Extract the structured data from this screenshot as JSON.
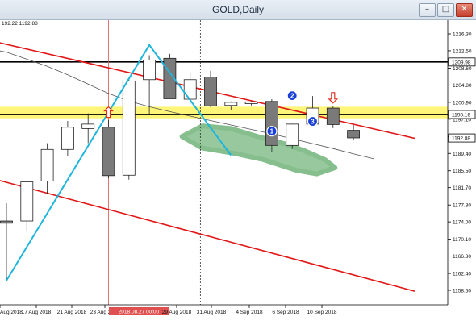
{
  "window": {
    "title": "GOLD,Daily",
    "minimize_icon": "minimize-icon",
    "maximize_icon": "maximize-icon",
    "close_icon": "close-icon"
  },
  "ohlc_readout": "192.22 1192.88",
  "chart_data": {
    "type": "candlestick",
    "price_axis_ticks": [
      "1216.30",
      "1212.50",
      "1208.60",
      "1204.80",
      "1200.90",
      "1197.10",
      "1193.20",
      "1189.40",
      "1185.50",
      "1181.70",
      "1177.80",
      "1174.00",
      "1170.10",
      "1166.30",
      "1162.40",
      "1158.60"
    ],
    "price_labels": [
      {
        "value": "1209.98",
        "bg": "#ffffff",
        "fg": "#000000"
      },
      {
        "value": "1198.16",
        "bg": "#ffffff",
        "fg": "#000000"
      },
      {
        "value": "1192.88",
        "bg": "#ffffff",
        "fg": "#000000"
      }
    ],
    "x_axis_labels": [
      "Aug 2018",
      "17 Aug 2018",
      "21 Aug 2018",
      "23 Aug 2018",
      "2018.08.27 00:00",
      "29 Aug 2018",
      "31 Aug 2018",
      "4 Sep 2018",
      "6 Sep 2018",
      "10 Sep 2018"
    ],
    "x_axis_highlight_label": "2018.08.27 00:00",
    "candles": [
      {
        "o": 1174.2,
        "h": 1178.2,
        "l": 1160.9,
        "c": 1173.7
      },
      {
        "o": 1174.2,
        "h": 1182.9,
        "l": 1172.0,
        "c": 1183.0
      },
      {
        "o": 1183.2,
        "h": 1191.7,
        "l": 1180.4,
        "c": 1190.3
      },
      {
        "o": 1190.3,
        "h": 1196.7,
        "l": 1188.9,
        "c": 1195.3
      },
      {
        "o": 1195.0,
        "h": 1198.4,
        "l": 1191.7,
        "c": 1196.0
      },
      {
        "o": 1195.3,
        "h": 1196.9,
        "l": 1183.8,
        "c": 1184.4
      },
      {
        "o": 1184.5,
        "h": 1206.3,
        "l": 1183.5,
        "c": 1205.7
      },
      {
        "o": 1206.0,
        "h": 1211.5,
        "l": 1198.0,
        "c": 1210.4
      },
      {
        "o": 1210.8,
        "h": 1211.8,
        "l": 1201.7,
        "c": 1201.7
      },
      {
        "o": 1201.6,
        "h": 1207.5,
        "l": 1200.4,
        "c": 1206.0
      },
      {
        "o": 1206.6,
        "h": 1208.0,
        "l": 1199.8,
        "c": 1200.1
      },
      {
        "o": 1200.2,
        "h": 1201.1,
        "l": 1199.2,
        "c": 1200.9
      },
      {
        "o": 1200.6,
        "h": 1201.2,
        "l": 1200.2,
        "c": 1201.0
      },
      {
        "o": 1201.1,
        "h": 1201.6,
        "l": 1189.7,
        "c": 1191.2
      },
      {
        "o": 1191.2,
        "h": 1196.1,
        "l": 1190.4,
        "c": 1196.0
      },
      {
        "o": 1196.0,
        "h": 1202.3,
        "l": 1195.7,
        "c": 1199.6
      },
      {
        "o": 1199.6,
        "h": 1200.0,
        "l": 1195.1,
        "c": 1195.9
      },
      {
        "o": 1194.6,
        "h": 1195.8,
        "l": 1192.3,
        "c": 1192.9
      }
    ],
    "horizontal_lines": [
      1209.98,
      1198.16
    ],
    "yellow_zone": [
      1197.3,
      1199.9
    ],
    "moving_average": [
      1213.0,
      1212.2,
      1210.6,
      1209.0,
      1207.1,
      1205.0,
      1202.9,
      1201.2,
      1199.9,
      1198.8,
      1197.8,
      1196.8,
      1195.8,
      1194.8,
      1193.8,
      1192.7,
      1191.6,
      1190.5,
      1189.3,
      1188.2
    ],
    "zigzag": [
      {
        "bar": 0,
        "price": 1160.8
      },
      {
        "bar": 7,
        "price": 1213.8
      },
      {
        "bar": 11,
        "price": 1189.0
      }
    ],
    "channel": {
      "upper": [
        {
          "bar": -8,
          "price": 1222.4
        },
        {
          "bar": 20,
          "price": 1192.8
        }
      ],
      "lower": [
        {
          "bar": -8,
          "price": 1192.7
        },
        {
          "bar": 20,
          "price": 1158.4
        }
      ]
    },
    "markers": [
      {
        "label": "1",
        "bar": 13,
        "price": 1194.4,
        "color": "#1a3fd6"
      },
      {
        "label": "2",
        "bar": 14,
        "price": 1202.4,
        "color": "#1a3fd6"
      },
      {
        "label": "3",
        "bar": 15,
        "price": 1196.6,
        "color": "#1a3fd6"
      }
    ],
    "arrows": [
      {
        "dir": "up",
        "bar": 5,
        "price": 1198.6,
        "color": "#e03020"
      },
      {
        "dir": "down",
        "bar": 16,
        "price": 1202.0,
        "color": "#e03020"
      }
    ],
    "vertical_lines": [
      {
        "bar": 5,
        "color": "#e05050",
        "style": "solid"
      },
      {
        "bar": 9.5,
        "color": "#303030",
        "style": "dotted"
      }
    ],
    "green_zone_color": "#86bf8d"
  }
}
